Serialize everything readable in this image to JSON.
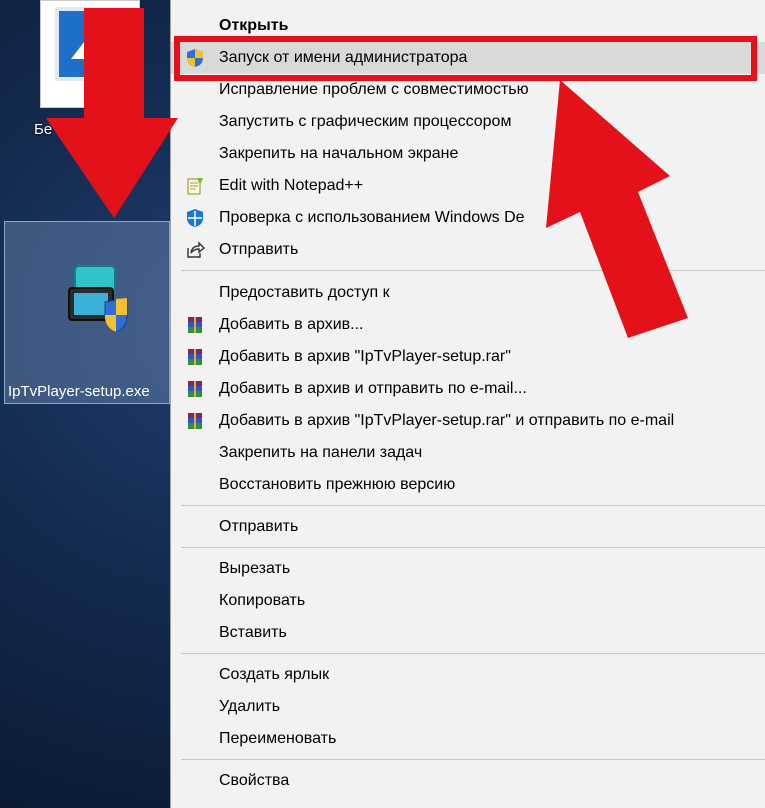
{
  "desktop": {
    "top_icon_label": "Бе",
    "selected_icon_label": "IpTvPlayer-setup.exe"
  },
  "colors": {
    "highlight_box": "#e4111b",
    "arrow": "#e4111b",
    "menu_bg": "#f2f2f2"
  },
  "menu": {
    "items": [
      {
        "label": "Открыть",
        "bold": true,
        "icon": ""
      },
      {
        "label": "Запуск от имени администратора",
        "icon": "uac-shield-icon"
      },
      {
        "label": "Исправление проблем с совместимостью",
        "icon": ""
      },
      {
        "label": "Запустить с графическим процессором",
        "icon": ""
      },
      {
        "label": "Закрепить на начальном экране",
        "icon": ""
      },
      {
        "label": "Edit with Notepad++",
        "icon": "notepad-plus-plus-icon"
      },
      {
        "label": "Проверка с использованием Windows De",
        "icon": "windows-defender-icon"
      },
      {
        "label": "Отправить",
        "icon": "share-icon"
      },
      {
        "label": "Предоставить доступ к",
        "icon": ""
      },
      {
        "label": "Добавить в архив...",
        "icon": "winrar-icon"
      },
      {
        "label": "Добавить в архив \"IpTvPlayer-setup.rar\"",
        "icon": "winrar-icon"
      },
      {
        "label": "Добавить в архив и отправить по e-mail...",
        "icon": "winrar-icon"
      },
      {
        "label": "Добавить в архив \"IpTvPlayer-setup.rar\" и отправить по e-mail",
        "icon": "winrar-icon"
      },
      {
        "label": "Закрепить на панели задач",
        "icon": ""
      },
      {
        "label": "Восстановить прежнюю версию",
        "icon": ""
      },
      {
        "label": "Отправить",
        "icon": ""
      },
      {
        "label": "Вырезать",
        "icon": ""
      },
      {
        "label": "Копировать",
        "icon": ""
      },
      {
        "label": "Вставить",
        "icon": ""
      },
      {
        "label": "Создать ярлык",
        "icon": ""
      },
      {
        "label": "Удалить",
        "icon": ""
      },
      {
        "label": "Переименовать",
        "icon": ""
      },
      {
        "label": "Свойства",
        "icon": ""
      }
    ]
  }
}
